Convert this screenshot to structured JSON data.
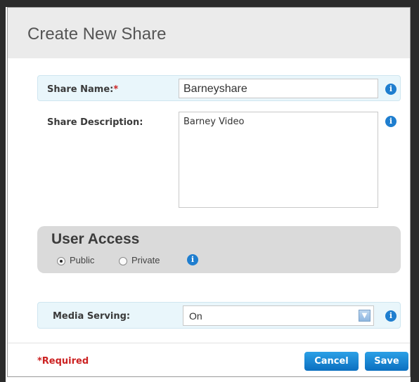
{
  "dialog": {
    "title": "Create New Share"
  },
  "share_name": {
    "label": "Share Name:",
    "required_marker": "*",
    "value": "Barneyshare"
  },
  "share_description": {
    "label": "Share Description:",
    "value": "Barney Video"
  },
  "user_access": {
    "title": "User Access",
    "options": [
      {
        "label": "Public",
        "selected": true
      },
      {
        "label": "Private",
        "selected": false
      }
    ]
  },
  "media_serving": {
    "label": "Media Serving:",
    "value": "On"
  },
  "footer": {
    "required_note": "*Required",
    "cancel_label": "Cancel",
    "save_label": "Save"
  },
  "icons": {
    "info": "info-icon",
    "dropdown": "chevron-down-icon"
  },
  "colors": {
    "accent": "#1a86d6",
    "required": "#cc2222",
    "highlight_row": "#e9f6fb"
  }
}
